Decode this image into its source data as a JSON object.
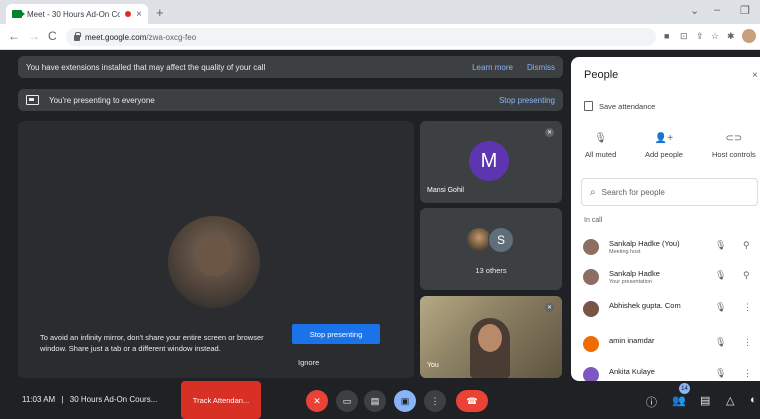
{
  "browser": {
    "tab_title": "Meet - 30 Hours Ad-On Co...",
    "tab_close": "×",
    "new_tab": "+",
    "url_host": "meet.google.com",
    "url_path": "/zwa-oxcg-feo",
    "win_minimize": "–",
    "win_restore": "❐",
    "win_chevron": "⌄",
    "back": "←",
    "forward": "→",
    "reload": "C",
    "toolbar_icons": [
      "■",
      "⊡",
      "⇪",
      "☆",
      "✱"
    ]
  },
  "meet": {
    "banner": {
      "text": "You have extensions installed that may affect the quality of your call",
      "learn_more": "Learn more",
      "dismiss": "Dismiss"
    },
    "presenting": {
      "text": "You're presenting to everyone",
      "stop_link": "Stop presenting"
    },
    "stage": {
      "mirror_warning": "To avoid an infinity mirror, don't share your entire screen or browser window. Share just a tab or a different window instead.",
      "stop_button": "Stop presenting",
      "ignore": "Ignore"
    },
    "tiles": {
      "t1": {
        "initial": "M",
        "name": "Mansi Gohil"
      },
      "t2": {
        "initial": "S",
        "others": "13 others"
      },
      "t3": {
        "name": "You"
      }
    },
    "bottom": {
      "time": "11:03 AM",
      "separator": "|",
      "meeting_name": "30 Hours Ad-On Cours...",
      "track_attendance": "Track Attendan...",
      "people_count": "14"
    }
  },
  "people_panel": {
    "title": "People",
    "close": "×",
    "save_attendance": "Save attendance",
    "actions": [
      {
        "label": "All muted",
        "icon": "mic-off-icon"
      },
      {
        "label": "Add people",
        "icon": "add-person-icon"
      },
      {
        "label": "Host controls",
        "icon": "host-controls-icon"
      }
    ],
    "search_placeholder": "Search for people",
    "in_call_label": "In call",
    "participants": [
      {
        "name": "Sankalp Hadke (You)",
        "sub": "Meeting host",
        "avatar_color": "#8d6e63"
      },
      {
        "name": "Sankalp Hadke",
        "sub": "Your presentation",
        "avatar_color": "#8d6e63"
      },
      {
        "name": "Abhishek gupta. Com",
        "sub": "",
        "avatar_color": "#795548"
      },
      {
        "name": "amin inamdar",
        "sub": "",
        "avatar_color": "#ef6c00"
      },
      {
        "name": "Ankita Kulaye",
        "sub": "",
        "avatar_color": "#7e57c2"
      }
    ]
  },
  "colors": {
    "meet_bg": "#202124",
    "tile_bg": "#3c4043",
    "accent_blue": "#1a73e8",
    "link_blue": "#8ab4f8",
    "red": "#ea4335",
    "avatar_purple": "#5e35b1"
  }
}
